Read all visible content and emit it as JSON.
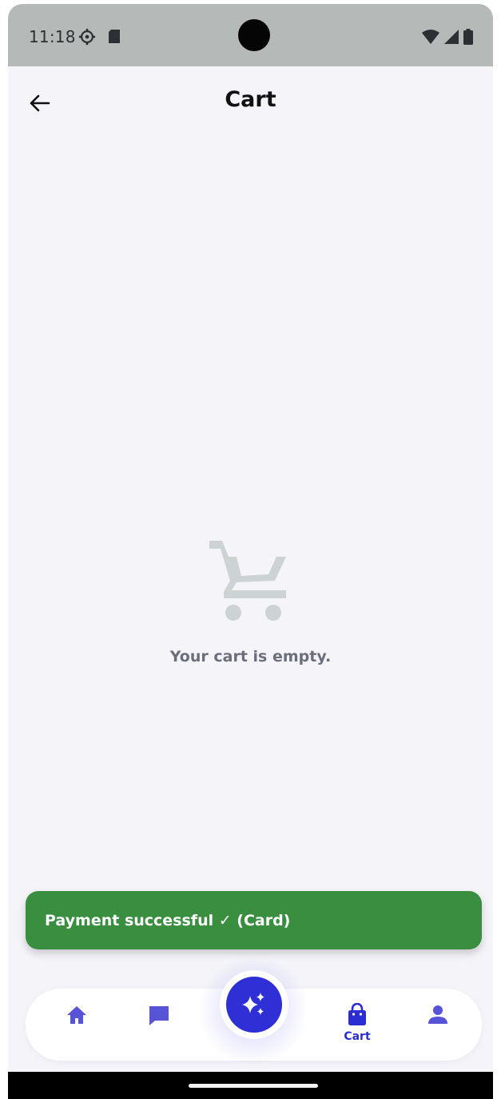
{
  "status_bar": {
    "time": "11:18",
    "icons": [
      "settings-icon",
      "sd-card-icon",
      "wifi-icon",
      "signal-icon",
      "battery-icon"
    ]
  },
  "header": {
    "title": "Cart",
    "back_icon": "arrow-left-icon"
  },
  "empty_state": {
    "icon": "shopping-cart-icon",
    "message": "Your cart is empty."
  },
  "snackbar": {
    "message": "Payment successful ✓ (Card)",
    "color": "#3a8e3f"
  },
  "bottom_nav": {
    "items": [
      {
        "icon": "home-icon",
        "label": ""
      },
      {
        "icon": "chat-icon",
        "label": ""
      },
      {
        "icon": "sparkle-icon",
        "label": ""
      },
      {
        "icon": "shopping-bag-icon",
        "label": "Cart",
        "active": true
      },
      {
        "icon": "person-icon",
        "label": ""
      }
    ],
    "accent_color": "#2f2fd6",
    "inactive_color": "#5754d8"
  }
}
